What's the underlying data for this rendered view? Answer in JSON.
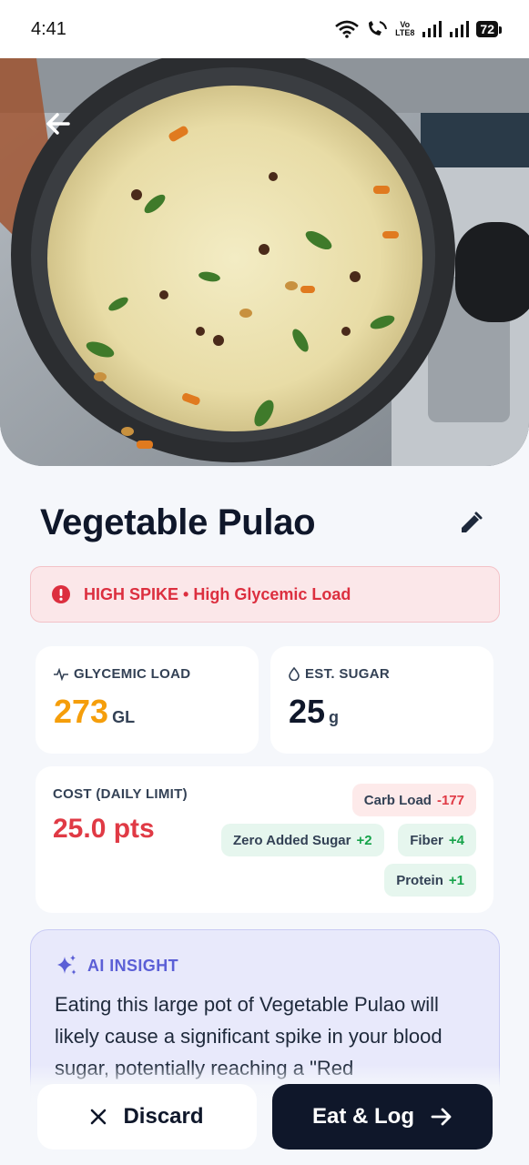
{
  "status_bar": {
    "time": "4:41",
    "volte_top": "Vo",
    "volte_bottom": "LTE8",
    "battery": "72"
  },
  "hero": {
    "image_icon": "vegetable-pulao-photo",
    "back_icon": "arrow-left-icon"
  },
  "dish": {
    "name": "Vegetable Pulao",
    "edit_icon": "pencil-icon"
  },
  "alert": {
    "text": "HIGH SPIKE • High Glycemic Load",
    "color": "#dc2f3f"
  },
  "metrics": {
    "glycemic_load": {
      "label": "GLYCEMIC LOAD",
      "value": "273",
      "unit": "GL",
      "color": "#f59e0b"
    },
    "est_sugar": {
      "label": "EST. SUGAR",
      "value": "25",
      "unit": "g"
    }
  },
  "cost": {
    "label": "COST (DAILY LIMIT)",
    "value": "25.0 pts",
    "chips": [
      {
        "label": "Carb Load",
        "delta": "-177",
        "kind": "negative"
      },
      {
        "label": "Zero Added Sugar",
        "delta": "+2",
        "kind": "positive"
      },
      {
        "label": "Fiber",
        "delta": "+4",
        "kind": "positive"
      },
      {
        "label": "Protein",
        "delta": "+1",
        "kind": "positive"
      }
    ]
  },
  "insight": {
    "title": "AI INSIGHT",
    "text": "Eating this large pot of Vegetable Pulao will likely cause a significant spike in your blood sugar, potentially reaching a \"Red"
  },
  "actions": {
    "discard": "Discard",
    "eat_log": "Eat & Log"
  },
  "colors": {
    "accent_dark": "#0f172a",
    "danger": "#e03a45",
    "success": "#16a34a",
    "insight": "#5b5fd6"
  }
}
